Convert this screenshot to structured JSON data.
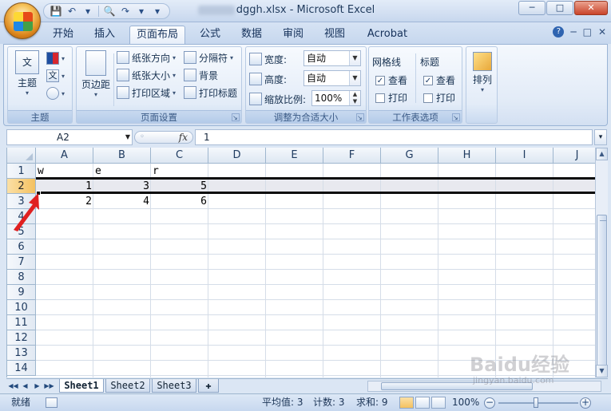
{
  "window": {
    "title": "dggh.xlsx - Microsoft Excel",
    "min": "─",
    "max": "□",
    "close": "✕"
  },
  "qat": {
    "save_icon": "💾",
    "undo_icon": "↶",
    "print_icon": "🔍",
    "redo_icon": "↷",
    "more_icon": "▾"
  },
  "tabs": [
    {
      "label": "开始"
    },
    {
      "label": "插入"
    },
    {
      "label": "页面布局"
    },
    {
      "label": "公式"
    },
    {
      "label": "数据"
    },
    {
      "label": "审阅"
    },
    {
      "label": "视图"
    },
    {
      "label": "Acrobat"
    }
  ],
  "tabs_right": {
    "help": "?",
    "min": "─",
    "restore": "□",
    "close": "✕"
  },
  "ribbon": {
    "themes": {
      "theme_btn": "主题",
      "colors_dd": "▾",
      "fonts": "文",
      "effects": "",
      "label": "主题"
    },
    "page_setup": {
      "margins": "页边距",
      "orientation": "纸张方向",
      "size": "纸张大小",
      "print_area": "打印区域",
      "breaks": "分隔符",
      "background": "背景",
      "print_titles": "打印标题",
      "label": "页面设置",
      "launcher": "↘"
    },
    "scale_to_fit": {
      "width_label": "宽度:",
      "width_value": "自动",
      "height_label": "高度:",
      "height_value": "自动",
      "scale_label": "缩放比例:",
      "scale_value": "100%",
      "label": "调整为合适大小",
      "launcher": "↘"
    },
    "sheet_options": {
      "gridlines": "网格线",
      "headings": "标题",
      "view1": "查看",
      "print1": "打印",
      "view2": "查看",
      "print2": "打印",
      "check": "✓",
      "label": "工作表选项",
      "launcher": "↘"
    },
    "arrange": {
      "label": "排列",
      "dd": "▾"
    }
  },
  "formula_bar": {
    "name_box": "A2",
    "fx": "fx",
    "value": "1",
    "expand": "▾"
  },
  "columns": [
    "A",
    "B",
    "C",
    "D",
    "E",
    "F",
    "G",
    "H",
    "I",
    "J"
  ],
  "rows": [
    "1",
    "2",
    "3",
    "4",
    "5",
    "6",
    "7",
    "8",
    "9",
    "10",
    "11",
    "12",
    "13",
    "14"
  ],
  "cells": {
    "A1": "w",
    "B1": "e",
    "C1": "r",
    "A2": "1",
    "B2": "3",
    "C2": "5",
    "A3": "2",
    "B3": "4",
    "C3": "6"
  },
  "sheets": [
    {
      "name": "Sheet1",
      "active": true
    },
    {
      "name": "Sheet2",
      "active": false
    },
    {
      "name": "Sheet3",
      "active": false
    }
  ],
  "sheet_nav": {
    "first": "◀◀",
    "prev": "◀",
    "next": "▶",
    "last": "▶▶"
  },
  "status": {
    "ready": "就绪",
    "average": "平均值: 3",
    "count": "计数: 3",
    "sum": "求和: 9",
    "zoom": "100%",
    "zoom_out": "−",
    "zoom_in": "+"
  },
  "watermark": {
    "brand": "Baidu经验",
    "url": "jingyan.baidu.com"
  },
  "colors": {
    "accent": "#f4c160",
    "highlight_row": "#e8e9ef",
    "arrow": "#e02020"
  }
}
